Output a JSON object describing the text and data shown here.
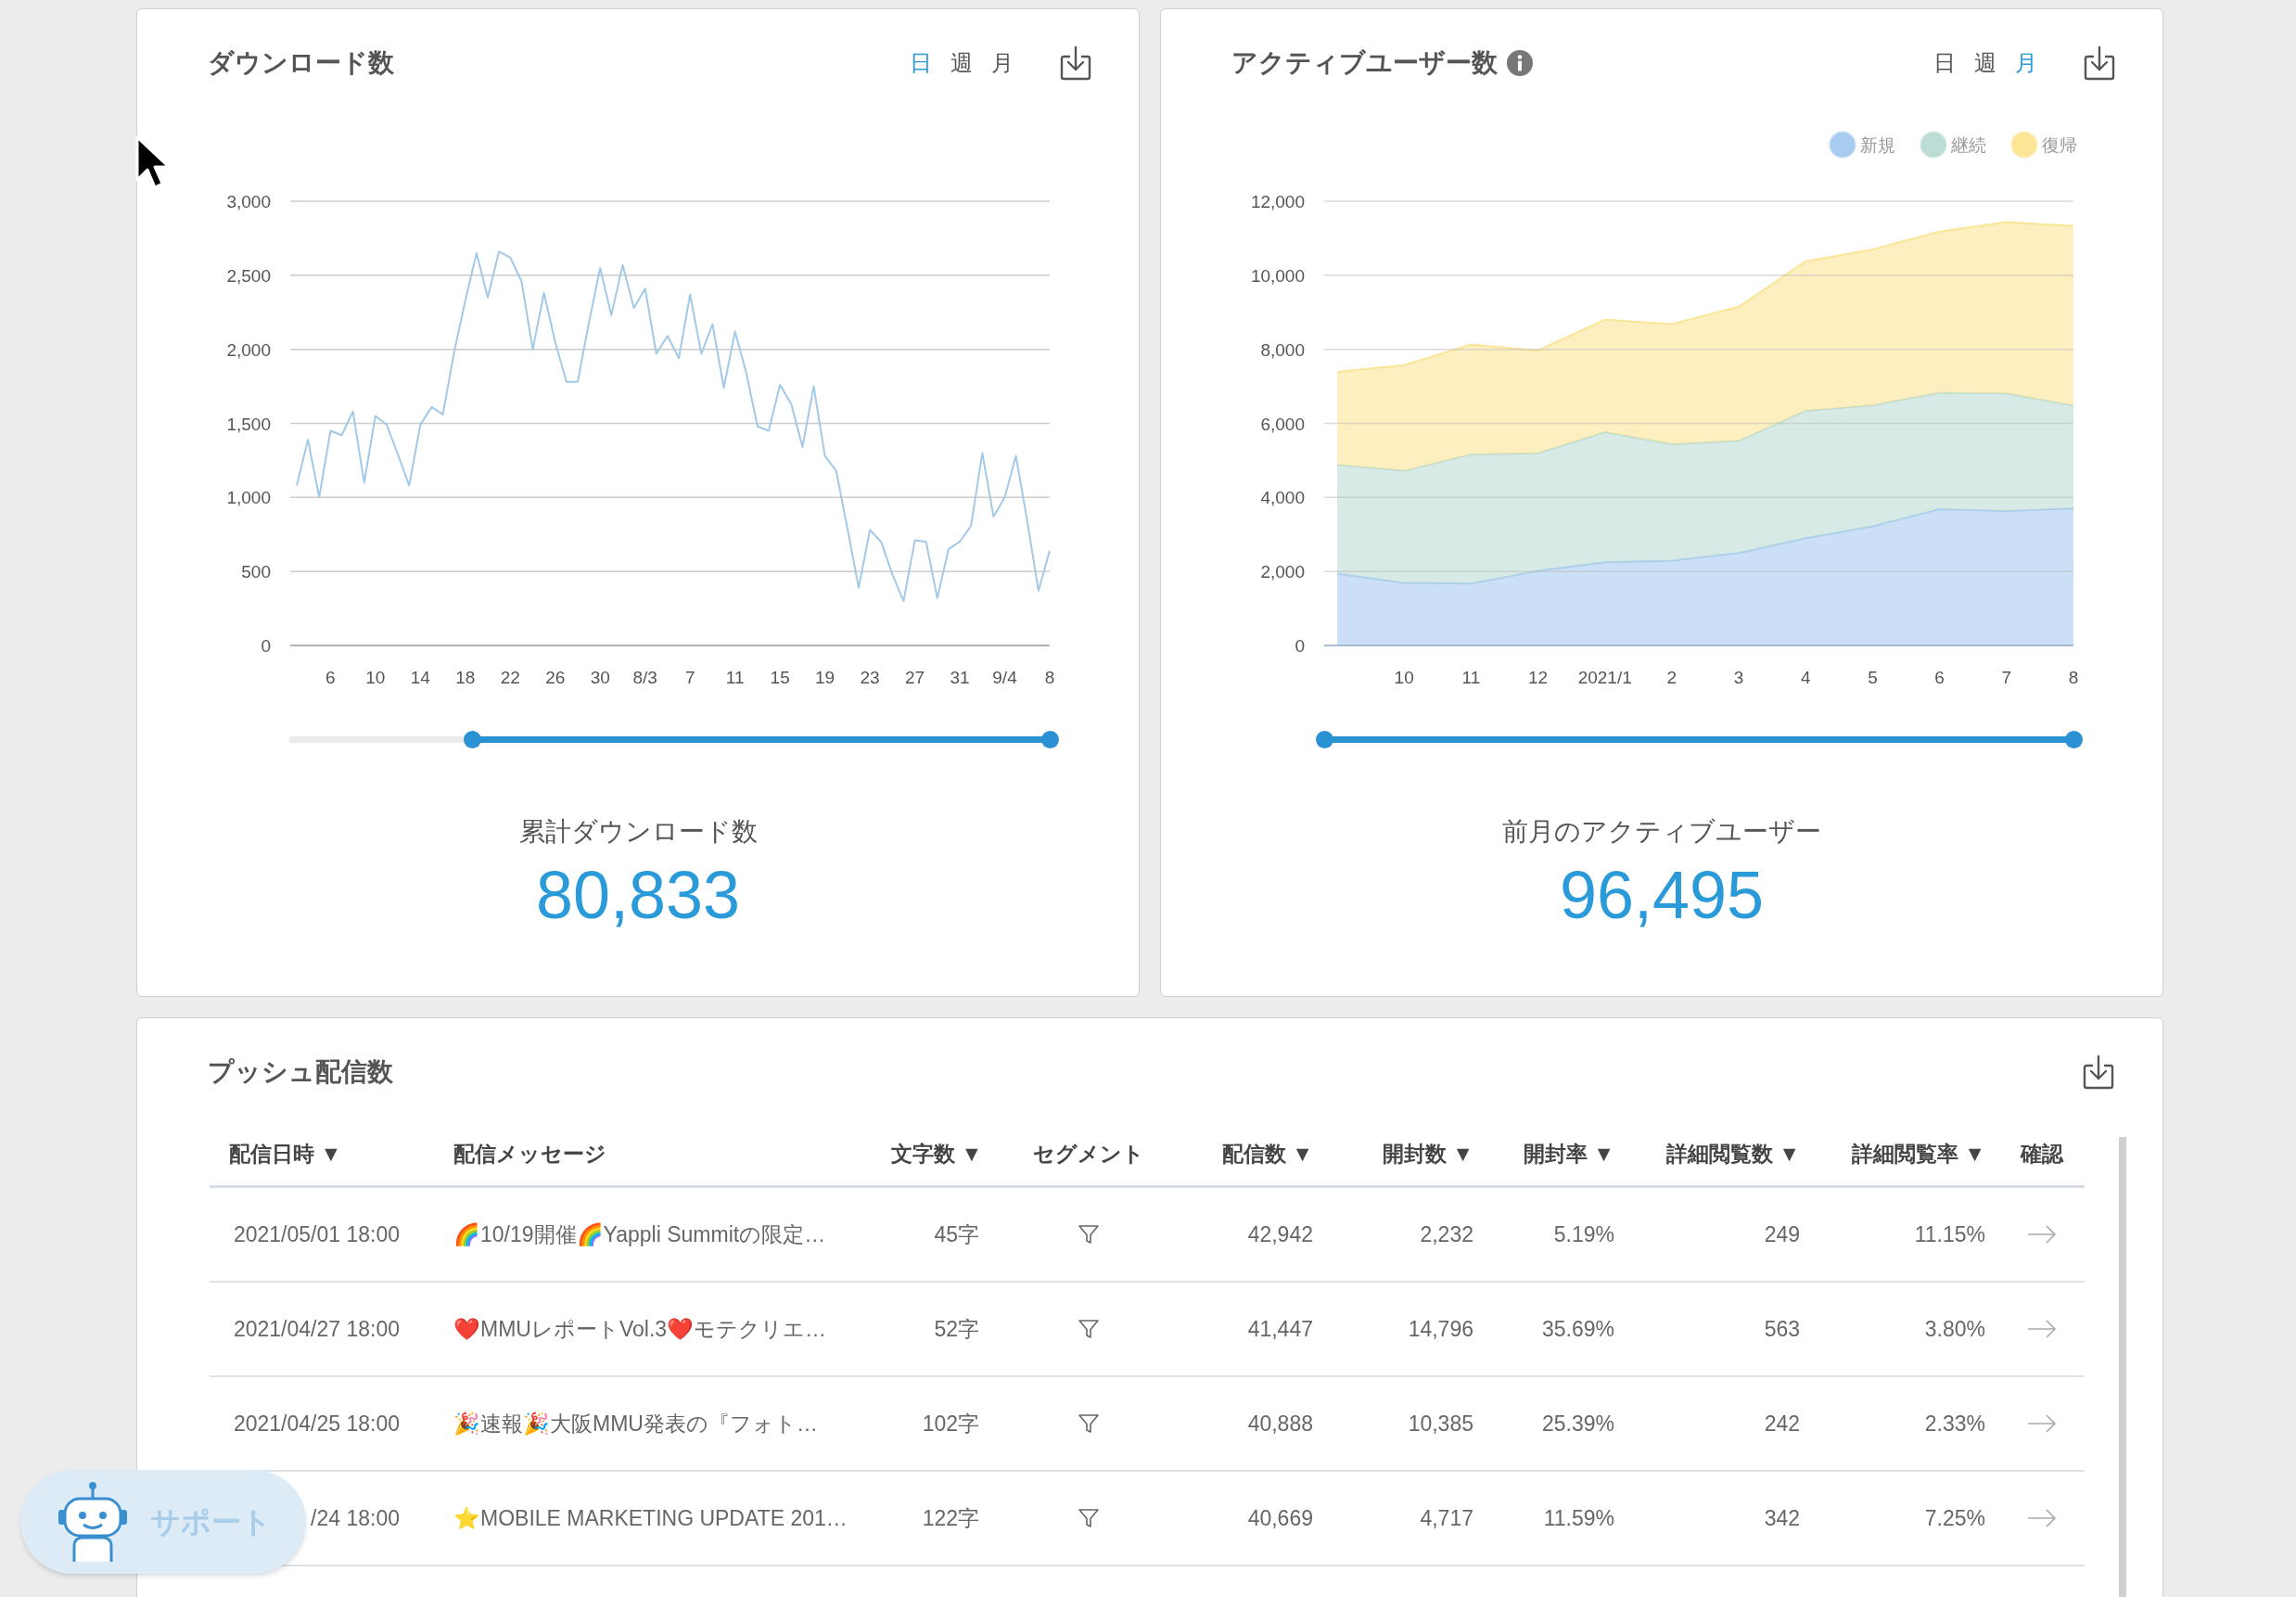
{
  "downloads": {
    "title": "ダウンロード数",
    "periods": [
      {
        "label": "日",
        "selected": true
      },
      {
        "label": "週",
        "selected": false
      },
      {
        "label": "月",
        "selected": false
      }
    ],
    "chart_data": {
      "type": "line",
      "grid": true,
      "categories": [
        null,
        null,
        null,
        "6",
        null,
        null,
        null,
        "10",
        null,
        null,
        null,
        "14",
        null,
        null,
        null,
        "18",
        null,
        null,
        null,
        "22",
        null,
        null,
        null,
        "26",
        null,
        null,
        null,
        "30",
        null,
        null,
        null,
        "8/3",
        null,
        null,
        null,
        "7",
        null,
        null,
        null,
        "11",
        null,
        null,
        null,
        "15",
        null,
        null,
        null,
        "19",
        null,
        null,
        null,
        "23",
        null,
        null,
        null,
        "27",
        null,
        null,
        null,
        "31",
        null,
        null,
        null,
        "9/4",
        null,
        null,
        null,
        "8"
      ],
      "ylim": [
        0,
        3000
      ],
      "yticks": [
        {
          "value": 0,
          "label": "0"
        },
        {
          "value": 500,
          "label": "500"
        },
        {
          "value": 1000,
          "label": "1,000"
        },
        {
          "value": 1500,
          "label": "1,500"
        },
        {
          "value": 2000,
          "label": "2,000"
        },
        {
          "value": 2500,
          "label": "2,500"
        },
        {
          "value": 3000,
          "label": "3,000"
        }
      ],
      "series": [
        {
          "color": "#a3c9e8",
          "values": [
            1080,
            1390,
            1000,
            1450,
            1420,
            1580,
            1100,
            1550,
            1490,
            1290,
            1080,
            1490,
            1610,
            1560,
            1980,
            2330,
            2650,
            2350,
            2660,
            2620,
            2460,
            2000,
            2380,
            2050,
            1780,
            1780,
            2180,
            2550,
            2230,
            2570,
            2280,
            2410,
            1970,
            2090,
            1940,
            2370,
            1970,
            2170,
            1740,
            2120,
            1840,
            1480,
            1450,
            1760,
            1630,
            1340,
            1750,
            1280,
            1180,
            790,
            390,
            780,
            700,
            480,
            300,
            710,
            700,
            320,
            650,
            700,
            810,
            1300,
            870,
            1000,
            1280,
            840,
            370,
            640
          ]
        }
      ]
    },
    "range_slider": {
      "thumbs": [
        {
          "level": 0.24
        },
        {
          "level": 1
        }
      ]
    },
    "summary_label": "累計ダウンロード数",
    "summary_value": "80,833"
  },
  "active_users": {
    "title": "アクティブユーザー数",
    "periods": [
      {
        "label": "日",
        "selected": false
      },
      {
        "label": "週",
        "selected": false
      },
      {
        "label": "月",
        "selected": true
      }
    ],
    "chart_data": {
      "type": "area",
      "stacked": true,
      "grid": true,
      "legend": "top-right",
      "categories": [
        null,
        "10",
        "11",
        "12",
        "2021/1",
        "2",
        "3",
        "4",
        "5",
        "6",
        "7",
        "8"
      ],
      "ylim": [
        0,
        12000
      ],
      "yticks": [
        {
          "value": 0,
          "label": "0"
        },
        {
          "value": 2000,
          "label": "2,000"
        },
        {
          "value": 4000,
          "label": "4,000"
        },
        {
          "value": 6000,
          "label": "6,000"
        },
        {
          "value": 8000,
          "label": "8,000"
        },
        {
          "value": 10000,
          "label": "10,000"
        },
        {
          "value": 12000,
          "label": "12,000"
        }
      ],
      "series": [
        {
          "name": "新規",
          "color": "#a8ccf0",
          "values": [
            1940,
            1690,
            1670,
            2020,
            2250,
            2290,
            2500,
            2900,
            3220,
            3680,
            3630,
            3700
          ]
        },
        {
          "name": "継続",
          "color": "#bcdcd5",
          "values": [
            2940,
            3030,
            3490,
            3170,
            3510,
            3150,
            3030,
            3440,
            3270,
            3150,
            3180,
            2780
          ]
        },
        {
          "name": "復帰",
          "color": "#fbe596",
          "values": [
            2510,
            2850,
            2970,
            2780,
            3040,
            3240,
            3620,
            4040,
            4210,
            4350,
            4630,
            4850
          ]
        }
      ]
    },
    "range_slider": {
      "thumbs": [
        {
          "level": 0
        },
        {
          "level": 1
        }
      ]
    },
    "summary_label": "前月のアクティブユーザー",
    "summary_value": "96,495"
  },
  "push": {
    "title": "プッシュ配信数",
    "columns": [
      {
        "label": "配信日時 ▼"
      },
      {
        "label": "配信メッセージ"
      },
      {
        "label": "文字数 ▼"
      },
      {
        "label": "セグメント"
      },
      {
        "label": "配信数 ▼"
      },
      {
        "label": "開封数 ▼"
      },
      {
        "label": "開封率 ▼"
      },
      {
        "label": "詳細閲覧数 ▼"
      },
      {
        "label": "詳細閲覧率 ▼"
      },
      {
        "label": "確認"
      }
    ],
    "rows": [
      {
        "date": "2021/05/01 18:00",
        "message": "🌈10/19開催🌈Yappli Summitの限定…",
        "chars": "45字",
        "deliveries": "42,942",
        "opens": "2,232",
        "open_rate": "5.19%",
        "detail_views": "249",
        "detail_rate": "11.15%"
      },
      {
        "date": "2021/04/27 18:00",
        "message": "❤️MMUレポートVol.3❤️モテクリエ…",
        "chars": "52字",
        "deliveries": "41,447",
        "opens": "14,796",
        "open_rate": "35.69%",
        "detail_views": "563",
        "detail_rate": "3.80%"
      },
      {
        "date": "2021/04/25 18:00",
        "message": "🎉速報🎉大阪MMU発表の『フォト…",
        "chars": "102字",
        "deliveries": "40,888",
        "opens": "10,385",
        "open_rate": "25.39%",
        "detail_views": "242",
        "detail_rate": "2.33%"
      },
      {
        "date": "/24 18:00",
        "message": "⭐MOBILE MARKETING UPDATE 201…",
        "chars": "122字",
        "deliveries": "40,669",
        "opens": "4,717",
        "open_rate": "11.59%",
        "detail_views": "342",
        "detail_rate": "7.25%"
      }
    ]
  },
  "support_button": {
    "label": "サポート"
  }
}
